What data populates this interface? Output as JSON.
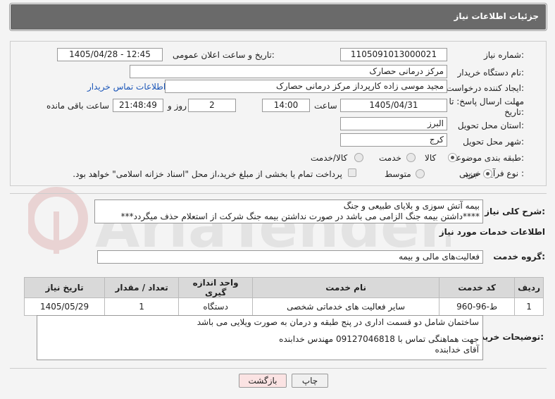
{
  "header": {
    "title": "جزئیات اطلاعات نیاز"
  },
  "form": {
    "need_number_label": "شماره نیاز:",
    "need_number": "1105091013000021",
    "announce_label": "تاریخ و ساعت اعلان عمومی:",
    "announce_value": "1405/04/28 - 12:45",
    "buyer_org_label": "نام دستگاه خریدار:",
    "buyer_org": "مرکز درمانی حصارک",
    "requester_label": "ایجاد کننده درخواست:",
    "requester": "مجید  موسی زاده کارپرداز مرکز درمانی حصارک",
    "contact_link": "اطلاعات تماس خریدار",
    "deadline_label": "مهلت ارسال پاسخ: تا تاریخ:",
    "deadline_date": "1405/04/31",
    "time_label": "ساعت",
    "deadline_time": "14:00",
    "days_value": "2",
    "days_label": "روز و",
    "remaining_time": "21:48:49",
    "remaining_label": "ساعت باقی مانده",
    "province_label": "استان محل تحویل:",
    "province": "البرز",
    "city_label": "شهر محل تحویل:",
    "city": "کرج",
    "category_label": "طبقه بندی موضوعی:",
    "category_options": [
      "کالا",
      "خدمت",
      "کالا/خدمت"
    ],
    "category_selected": "کالا",
    "process_label": "نوع فرآیند خرید :",
    "process_options": [
      "جزیی",
      "متوسط"
    ],
    "process_selected": "جزیی",
    "payment_note": "پرداخت تمام یا بخشی از مبلغ خرید،از محل \"اسناد خزانه اسلامی\" خواهد بود."
  },
  "description": {
    "label": "شرح کلی نیاز:",
    "line1": "بیمه آتش سوزی و بلایای طبیعی و جنگ",
    "line2": "****داشتن بیمه جنگ الزامی می باشد در صورت نداشتن بیمه جنگ شرکت از استعلام حذف میگردد***"
  },
  "services": {
    "section_title": "اطلاعات خدمات مورد نیاز",
    "group_label": "گروه خدمت:",
    "group_value": "فعالیت‌های مالی و بیمه",
    "columns": [
      "ردیف",
      "کد خدمت",
      "نام خدمت",
      "واحد اندازه گیری",
      "تعداد / مقدار",
      "تاریخ نیاز"
    ],
    "rows": [
      [
        "1",
        "ط-96-960",
        "سایر فعالیت های خدماتی شخصی",
        "دستگاه",
        "1",
        "1405/05/29"
      ]
    ]
  },
  "buyer_notes": {
    "label": "توضیحات خریدار:",
    "line1": "ساختمان شامل دو قسمت اداری در پنج طبقه و درمان به صورت ویلایی می باشد",
    "line2": "جهت هماهنگی تماس با 09127046818  مهندس خدابنده",
    "line3": "آقای خدابنده"
  },
  "buttons": {
    "print": "چاپ",
    "back": "بازگشت"
  },
  "watermark": {
    "text": "AriaTender.net"
  },
  "colors": {
    "header_bg": "#6a6a6a",
    "link": "#1a55b8",
    "back_button_bg": "#fbe3e3"
  }
}
